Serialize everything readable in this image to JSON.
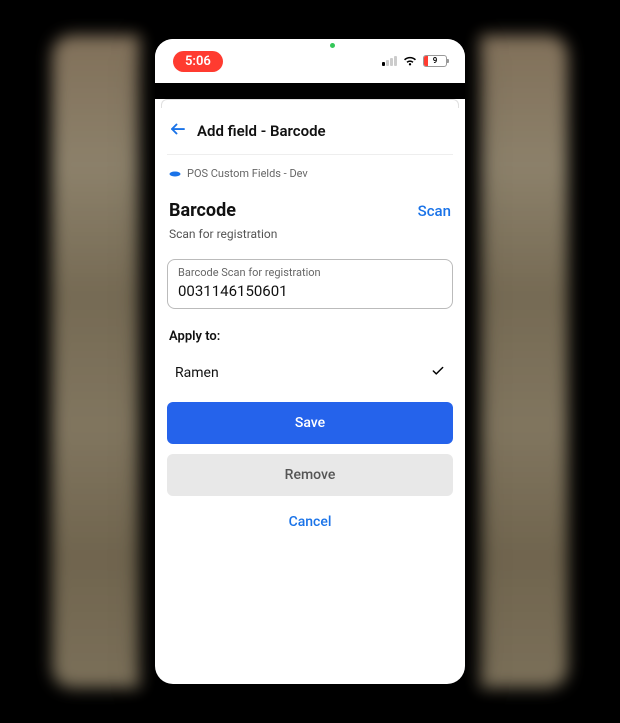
{
  "statusBar": {
    "time": "5:06",
    "batteryLevel": "9"
  },
  "header": {
    "title": "Add field - Barcode"
  },
  "appBadge": "POS Custom Fields - Dev",
  "section": {
    "title": "Barcode",
    "scanAction": "Scan",
    "subtitle": "Scan for registration"
  },
  "input": {
    "label": "Barcode Scan for registration",
    "value": "0031146150601"
  },
  "applyTo": {
    "label": "Apply to:",
    "items": [
      {
        "name": "Ramen",
        "selected": true
      }
    ]
  },
  "buttons": {
    "save": "Save",
    "remove": "Remove",
    "cancel": "Cancel"
  }
}
